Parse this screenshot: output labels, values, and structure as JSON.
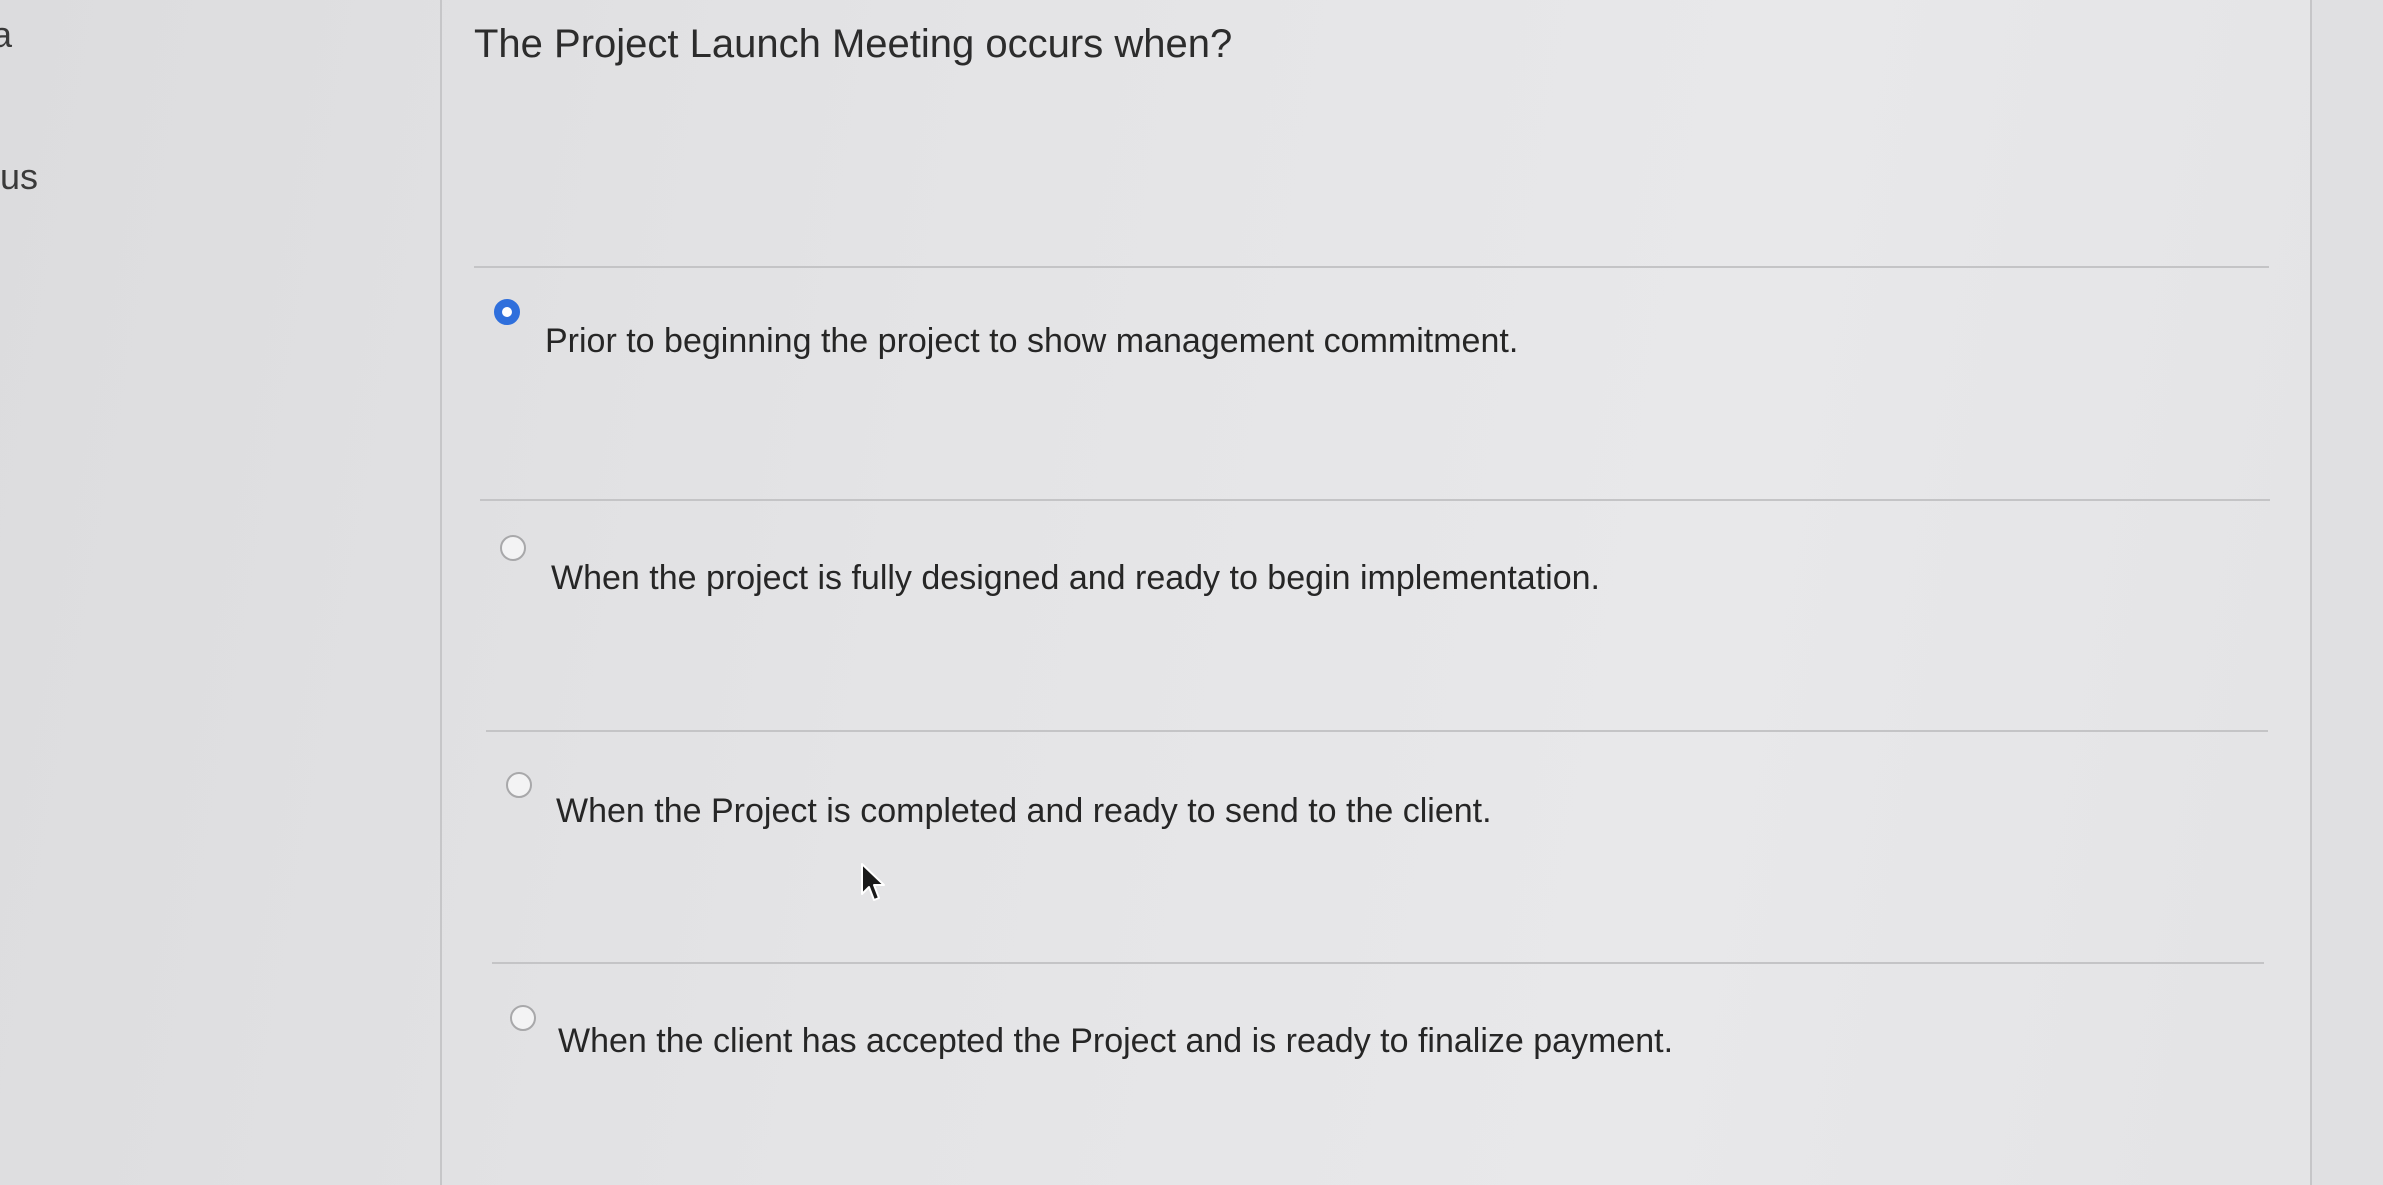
{
  "sidebar": {
    "fragment_top": "a",
    "fragment_middle": "us"
  },
  "question": {
    "text": "The Project Launch Meeting occurs when?"
  },
  "options": [
    {
      "label": "Prior to beginning the project to show management commitment.",
      "selected": true
    },
    {
      "label": "When the project is fully designed and ready to begin implementation.",
      "selected": false
    },
    {
      "label": "When the Project is completed and ready to send to the client.",
      "selected": false
    },
    {
      "label": "When the client has accepted the Project and is ready to finalize payment.",
      "selected": false
    }
  ],
  "colors": {
    "accent": "#2f6fdc",
    "background": "#e4e4e6",
    "text": "#262626"
  },
  "icons": {
    "pointer": "mouse-cursor-icon"
  }
}
